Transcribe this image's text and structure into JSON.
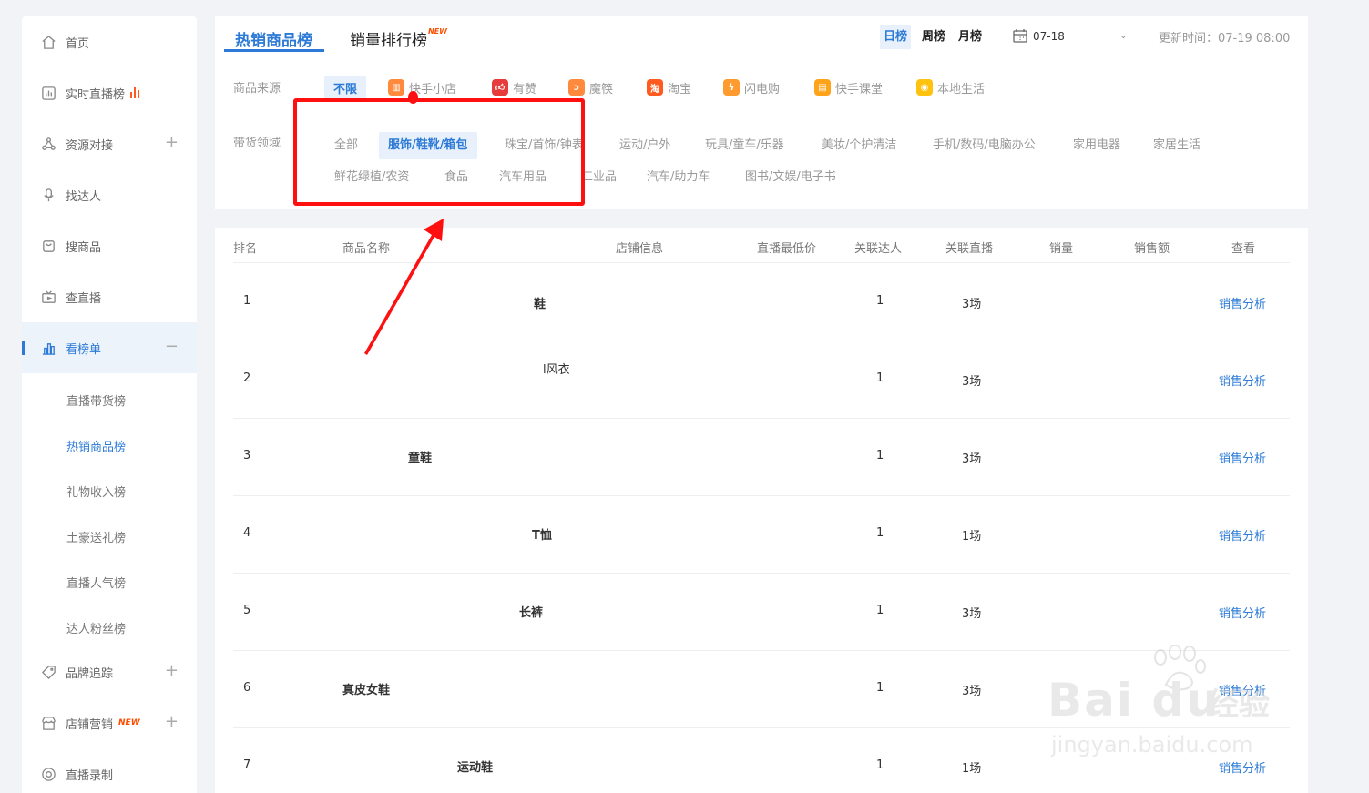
{
  "sidebar": {
    "items": [
      {
        "label": "首页"
      },
      {
        "label": "实时直播榜"
      },
      {
        "label": "资源对接"
      },
      {
        "label": "找达人"
      },
      {
        "label": "搜商品"
      },
      {
        "label": "查直播"
      },
      {
        "label": "看榜单"
      },
      {
        "label": "品牌追踪"
      },
      {
        "label": "店铺营销",
        "badge": "NEW"
      },
      {
        "label": "直播录制"
      }
    ],
    "sub_items": [
      "直播带货榜",
      "热销商品榜",
      "礼物收入榜",
      "土豪送礼榜",
      "直播人气榜",
      "达人粉丝榜"
    ]
  },
  "tabs": [
    {
      "label": "热销商品榜"
    },
    {
      "label": "销量排行榜",
      "badge": "NEW"
    }
  ],
  "periods": [
    "日榜",
    "周榜",
    "月榜"
  ],
  "date": {
    "value": "07-18"
  },
  "update_time": "更新时间：07-19 08:00",
  "filters": {
    "source_label": "商品来源",
    "sources": [
      {
        "label": "不限"
      },
      {
        "label": "快手小店"
      },
      {
        "label": "有赞"
      },
      {
        "label": "魔筷"
      },
      {
        "label": "淘宝",
        "glyph": "淘"
      },
      {
        "label": "闪电购"
      },
      {
        "label": "快手课堂"
      },
      {
        "label": "本地生活"
      }
    ],
    "category_label": "带货领域",
    "categories": [
      "全部",
      "服饰/鞋靴/箱包",
      "珠宝/首饰/钟表",
      "运动/户外",
      "玩具/童车/乐器",
      "美妆/个护清洁",
      "手机/数码/电脑办公",
      "家用电器",
      "家居生活",
      "鲜花绿植/农资",
      "食品",
      "汽车用品",
      "工业品",
      "汽车/助力车",
      "图书/文娱/电子书"
    ]
  },
  "table": {
    "columns": [
      "排名",
      "商品名称",
      "店铺信息",
      "直播最低价",
      "关联达人",
      "关联直播",
      "销量",
      "销售额",
      "查看"
    ],
    "rows": [
      {
        "rank": "1",
        "name": "鞋",
        "talent": "1",
        "live": "3场",
        "action": "销售分析"
      },
      {
        "rank": "2",
        "name": "l风衣",
        "talent": "1",
        "live": "3场",
        "action": "销售分析"
      },
      {
        "rank": "3",
        "name": "童鞋",
        "talent": "1",
        "live": "3场",
        "action": "销售分析"
      },
      {
        "rank": "4",
        "name": "T恤",
        "talent": "1",
        "live": "1场",
        "action": "销售分析"
      },
      {
        "rank": "5",
        "name": "长裤",
        "talent": "1",
        "live": "3场",
        "action": "销售分析"
      },
      {
        "rank": "6",
        "name": "真皮女鞋",
        "talent": "1",
        "live": "3场",
        "action": "销售分析"
      },
      {
        "rank": "7",
        "name": "运动鞋",
        "talent": "1",
        "live": "1场",
        "action": "销售分析"
      }
    ]
  },
  "watermark": {
    "brand": "Bai du",
    "cn": "经验",
    "url": "jingyan.baidu.com"
  },
  "colors": {
    "accent": "#2c7ad6",
    "annotation": "#ff1010",
    "new_badge": "#ff4d00"
  }
}
